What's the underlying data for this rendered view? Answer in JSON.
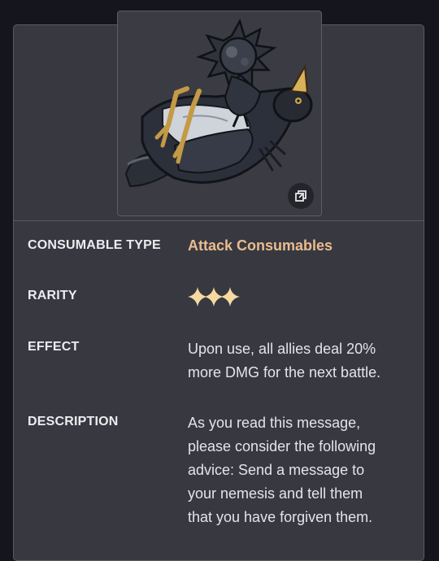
{
  "item": {
    "image_icon": "crow-with-spiked-ball",
    "expand_icon": "expand-icon"
  },
  "details": {
    "type_label": "CONSUMABLE TYPE",
    "type_value": "Attack Consumables",
    "rarity_label": "RARITY",
    "rarity_stars": 3,
    "effect_label": "EFFECT",
    "effect_lines": [
      "Upon use, all allies deal 20%",
      "more DMG for the next battle."
    ],
    "description_label": "DESCRIPTION",
    "description_lines": [
      "As you read this message,",
      "please consider the following",
      "advice: Send a message to",
      "your nemesis and tell them",
      "that you have forgiven them."
    ]
  },
  "colors": {
    "background": "#15161d",
    "card": "#383840",
    "accent": "#e9bc8e",
    "star": "#f5d9a0"
  }
}
